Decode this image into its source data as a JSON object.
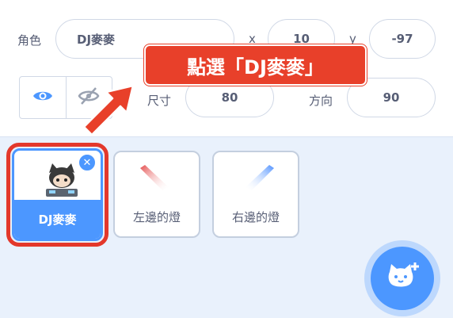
{
  "sprite_info": {
    "sprite_label": "角色",
    "sprite_name": "DJ麥麥",
    "x_label": "x",
    "x_value": "10",
    "y_label": "y",
    "y_value": "-97",
    "size_label": "尺寸",
    "size_value": "80",
    "direction_label": "方向",
    "direction_value": "90",
    "show_icon": "eye-icon",
    "hide_icon": "eye-slash-icon"
  },
  "callout": {
    "text": "點選「DJ麥麥」",
    "color": "#e8402a"
  },
  "sprites": [
    {
      "name": "DJ麥麥",
      "selected": true
    },
    {
      "name": "左邊的燈",
      "selected": false
    },
    {
      "name": "右邊的燈",
      "selected": false
    }
  ],
  "colors": {
    "accent": "#4c97ff",
    "highlight": "#e3382b",
    "background": "#e9f1fc"
  },
  "fab": {
    "icon": "add-sprite-cat-icon"
  }
}
